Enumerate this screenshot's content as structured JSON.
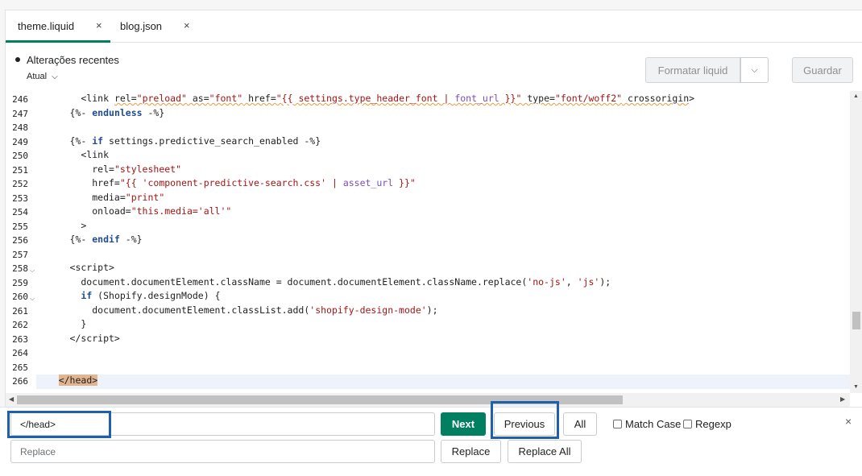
{
  "tabs": [
    {
      "label": "theme.liquid",
      "close": "×"
    },
    {
      "label": "blog.json",
      "close": "×"
    }
  ],
  "toolbar": {
    "recent_label": "Alterações recentes",
    "version_label": "Atual",
    "format_label": "Formatar liquid",
    "save_label": "Guardar"
  },
  "editor": {
    "lines": [
      {
        "n": "246"
      },
      {
        "n": "247"
      },
      {
        "n": "248"
      },
      {
        "n": "249"
      },
      {
        "n": "250"
      },
      {
        "n": "251"
      },
      {
        "n": "252"
      },
      {
        "n": "253"
      },
      {
        "n": "254"
      },
      {
        "n": "255"
      },
      {
        "n": "256"
      },
      {
        "n": "257"
      },
      {
        "n": "258"
      },
      {
        "n": "259"
      },
      {
        "n": "260"
      },
      {
        "n": "261"
      },
      {
        "n": "262"
      },
      {
        "n": "263"
      },
      {
        "n": "264"
      },
      {
        "n": "265"
      },
      {
        "n": "266"
      }
    ]
  },
  "find": {
    "value": "</head>",
    "next_label": "Next",
    "previous_label": "Previous",
    "all_label": "All",
    "match_case_label": "Match Case",
    "regexp_label": "Regexp",
    "close_label": "×"
  },
  "replace": {
    "placeholder": "Replace",
    "replace_label": "Replace",
    "replace_all_label": "Replace All"
  },
  "colors": {
    "primary": "#008060",
    "highlight_box": "#1f5fae",
    "match_highlight": "#e2b48f"
  }
}
